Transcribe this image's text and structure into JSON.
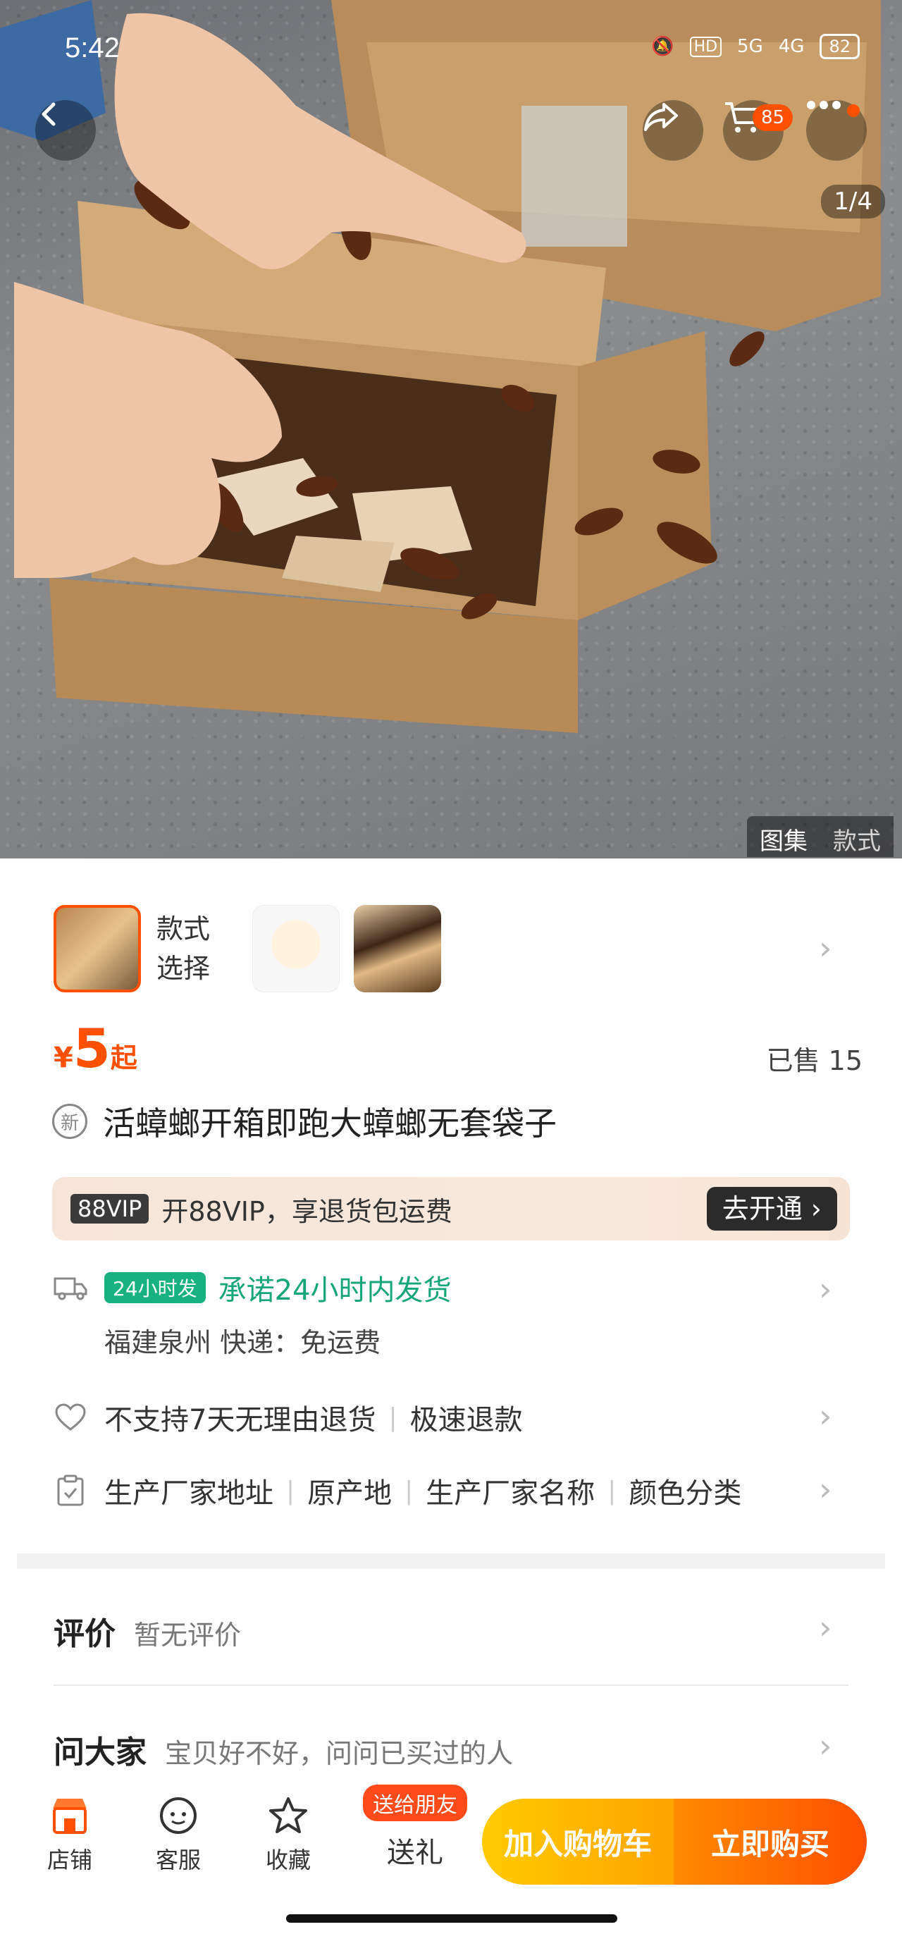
{
  "status_bar": {
    "time": "5:42",
    "net1": "5G",
    "net2": "4G",
    "hd": "HD",
    "battery": "82"
  },
  "top_nav": {
    "cart_count": "85"
  },
  "gallery": {
    "page_indicator": "1/4",
    "tab_gallery": "图集",
    "tab_style": "款式"
  },
  "variants": {
    "label_line1": "款式",
    "label_line2": "选择"
  },
  "price": {
    "symbol": "¥",
    "value": "5",
    "suffix": "起",
    "sold": "已售 15"
  },
  "product": {
    "new_badge": "新",
    "title": "活蟑螂开箱即跑大蟑螂无套袋子"
  },
  "vip": {
    "tag": "88VIP",
    "text": "开88VIP，享退货包运费",
    "button": "去开通 ›"
  },
  "shipping": {
    "tag": "24小时发",
    "promise": "承诺24小时内发货",
    "detail": "福建泉州  快递：免运费"
  },
  "returns": {
    "item1": "不支持7天无理由退货",
    "item2": "极速退款"
  },
  "params": {
    "items": [
      "生产厂家地址",
      "原产地",
      "生产厂家名称",
      "颜色分类"
    ]
  },
  "review": {
    "title": "评价",
    "sub": "暂无评价"
  },
  "ask": {
    "title": "问大家",
    "sub": "宝贝好不好，问问已买过的人"
  },
  "bottom_bar": {
    "shop": "店铺",
    "service": "客服",
    "favorite": "收藏",
    "gift_badge": "送给朋友",
    "gift": "送礼",
    "add_cart": "加入购物车",
    "buy_now": "立即购买"
  },
  "colors": {
    "accent": "#ff5000",
    "green": "#17a67a",
    "cart_yellow": "#ffb400"
  }
}
